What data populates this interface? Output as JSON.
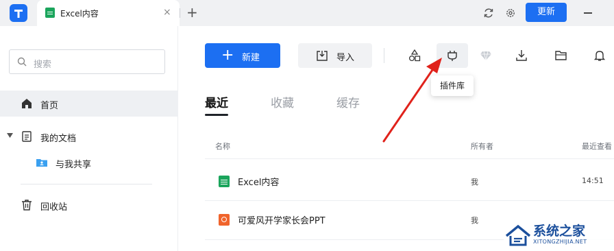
{
  "titlebar": {
    "tab_title": "Excel内容",
    "tab_close": "×",
    "new_tab": "+",
    "update_label": "更新"
  },
  "sidebar": {
    "search_placeholder": "搜索",
    "items": [
      {
        "label": "首页",
        "icon": "home-icon",
        "selected": true
      },
      {
        "label": "我的文档",
        "icon": "document-icon",
        "expanded": true
      },
      {
        "label": "与我共享",
        "icon": "shared-folder-icon"
      },
      {
        "label": "回收站",
        "icon": "trash-icon"
      }
    ]
  },
  "toolbar": {
    "new_label": "新建",
    "import_label": "导入",
    "tooltip": "插件库"
  },
  "file_tabs": [
    "最近",
    "收藏",
    "缓存"
  ],
  "table": {
    "headers": [
      "名称",
      "所有者",
      "最近查看"
    ],
    "rows": [
      {
        "name": "Excel内容",
        "type": "excel",
        "owner": "我",
        "time": "14:51"
      },
      {
        "name": "可爱风开学家长会PPT",
        "type": "ppt",
        "owner": "我",
        "time": ""
      }
    ]
  },
  "watermark": {
    "title": "系统之家",
    "subtitle": "XITONGZHIJIA.NET"
  },
  "colors": {
    "accent": "#1c6ff2",
    "excel_green": "#1ba55c",
    "ppt_orange": "#f0642c",
    "annotation_red": "#e0221b"
  }
}
